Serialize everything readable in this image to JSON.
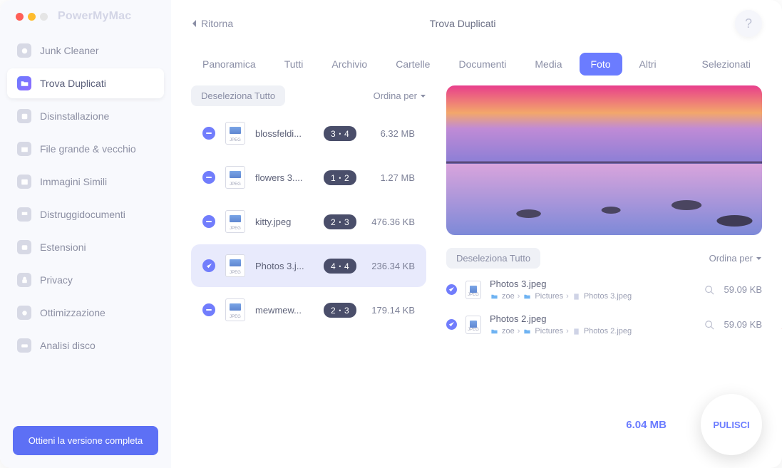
{
  "app_name": "PowerMyMac",
  "back_label": "Ritorna",
  "window_title": "Trova Duplicati",
  "help_label": "?",
  "sidebar": {
    "items": [
      {
        "label": "Junk Cleaner"
      },
      {
        "label": "Trova Duplicati"
      },
      {
        "label": "Disinstallazione"
      },
      {
        "label": "File grande & vecchio"
      },
      {
        "label": "Immagini Simili"
      },
      {
        "label": "Distruggidocumenti"
      },
      {
        "label": "Estensioni"
      },
      {
        "label": "Privacy"
      },
      {
        "label": "Ottimizzazione"
      },
      {
        "label": "Analisi disco"
      }
    ],
    "full_version_btn": "Ottieni la versione completa"
  },
  "tabs": [
    {
      "label": "Panoramica"
    },
    {
      "label": "Tutti"
    },
    {
      "label": "Archivio"
    },
    {
      "label": "Cartelle"
    },
    {
      "label": "Documenti"
    },
    {
      "label": "Media"
    },
    {
      "label": "Foto"
    },
    {
      "label": "Altri"
    },
    {
      "label": "Selezionati"
    }
  ],
  "active_tab_index": 6,
  "left": {
    "deselect_label": "Deseleziona Tutto",
    "sort_label": "Ordina per",
    "thumb_label": "JPEG",
    "rows": [
      {
        "name": "blossfeldi...",
        "badge": "3 ꞏ 4",
        "size": "6.32 MB"
      },
      {
        "name": "flowers 3....",
        "badge": "1 ꞏ 2",
        "size": "1.27 MB"
      },
      {
        "name": "kitty.jpeg",
        "badge": "2 ꞏ 3",
        "size": "476.36 KB"
      },
      {
        "name": "Photos 3.j...",
        "badge": "4 ꞏ 4",
        "size": "236.34 KB"
      },
      {
        "name": "mewmew...",
        "badge": "2 ꞏ 3",
        "size": "179.14 KB"
      }
    ],
    "selected_index": 3
  },
  "right": {
    "deselect_label": "Deseleziona Tutto",
    "sort_label": "Ordina per",
    "files": [
      {
        "name": "Photos 3.jpeg",
        "user": "zoe",
        "folder": "Pictures",
        "file": "Photos 3.jpeg",
        "size": "59.09 KB"
      },
      {
        "name": "Photos 2.jpeg",
        "user": "zoe",
        "folder": "Pictures",
        "file": "Photos 2.jpeg",
        "size": "59.09 KB"
      }
    ]
  },
  "total_size": "6.04 MB",
  "clean_label": "PULISCI"
}
